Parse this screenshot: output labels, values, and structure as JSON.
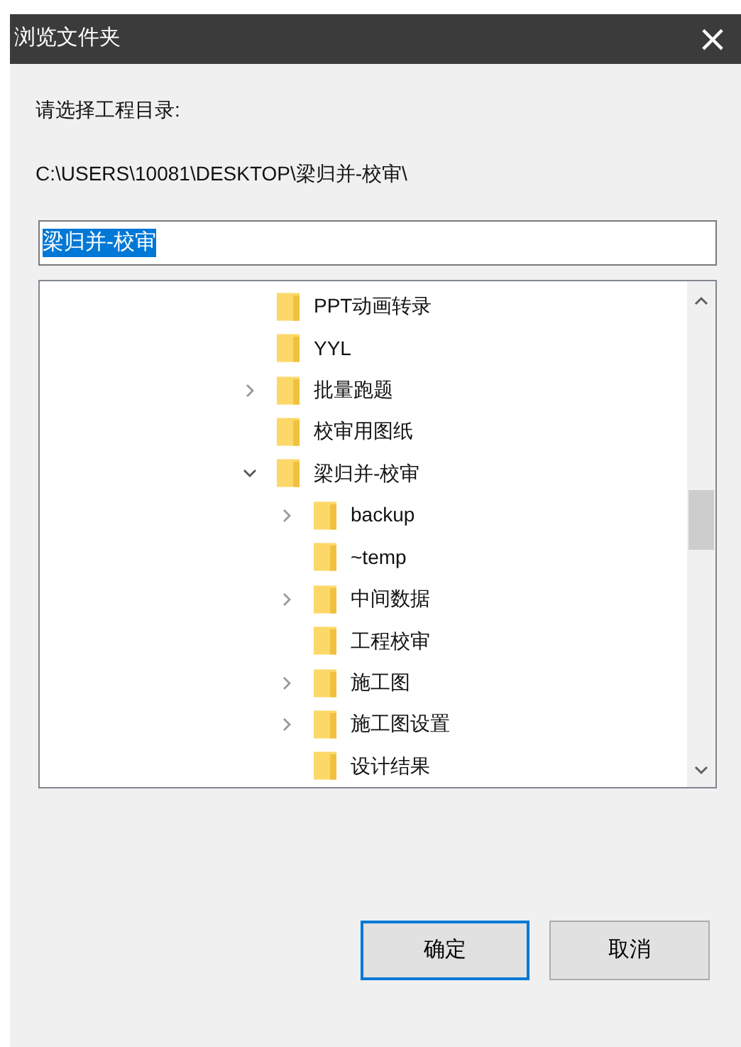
{
  "window": {
    "title": "浏览文件夹",
    "close": "×"
  },
  "prompt": "请选择工程目录:",
  "path": "C:\\USERS\\10081\\DESKTOP\\梁归并-校审\\",
  "folder_field": {
    "value": "梁归并-校审",
    "text_selected": true
  },
  "tree": [
    {
      "label": "PPT动画转录"
    },
    {
      "label": "YYL"
    },
    {
      "label": "批量跑题",
      "expanded": false
    },
    {
      "label": "校审用图纸"
    },
    {
      "label": "梁归并-校审",
      "expanded": true,
      "children": [
        {
          "label": "backup",
          "expanded": false
        },
        {
          "label": "~temp"
        },
        {
          "label": "中间数据",
          "expanded": false
        },
        {
          "label": "工程校审"
        },
        {
          "label": "施工图",
          "expanded": false
        },
        {
          "label": "施工图设置",
          "expanded": false
        },
        {
          "label": "设计结果"
        }
      ]
    }
  ],
  "buttons": [
    {
      "label": "确定",
      "default": true
    },
    {
      "label": "取消",
      "default": false
    }
  ]
}
